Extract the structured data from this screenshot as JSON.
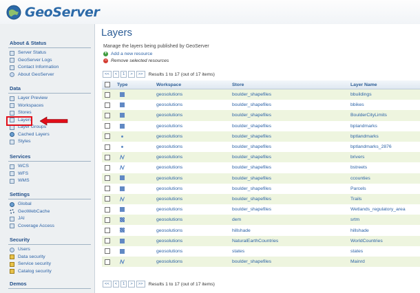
{
  "app": {
    "name": "GeoServer"
  },
  "sidebar": {
    "sections": [
      {
        "title": "About & Status",
        "items": [
          {
            "label": "Server Status",
            "icon": "server-status-icon"
          },
          {
            "label": "GeoServer Logs",
            "icon": "logs-icon"
          },
          {
            "label": "Contact Information",
            "icon": "contact-icon"
          },
          {
            "label": "About GeoServer",
            "icon": "about-icon"
          }
        ]
      },
      {
        "title": "Data",
        "items": [
          {
            "label": "Layer Preview",
            "icon": "layer-preview-icon"
          },
          {
            "label": "Workspaces",
            "icon": "workspaces-icon"
          },
          {
            "label": "Stores",
            "icon": "stores-icon"
          },
          {
            "label": "Layers",
            "icon": "layers-icon"
          },
          {
            "label": "Layer Groups",
            "icon": "layer-groups-icon"
          },
          {
            "label": "Cached Layers",
            "icon": "cached-layers-icon"
          },
          {
            "label": "Styles",
            "icon": "styles-icon"
          }
        ]
      },
      {
        "title": "Services",
        "items": [
          {
            "label": "WCS",
            "icon": "wcs-icon"
          },
          {
            "label": "WFS",
            "icon": "wfs-icon"
          },
          {
            "label": "WMS",
            "icon": "wms-icon"
          }
        ]
      },
      {
        "title": "Settings",
        "items": [
          {
            "label": "Global",
            "icon": "global-icon"
          },
          {
            "label": "GeoWebCache",
            "icon": "geowebcache-icon"
          },
          {
            "label": "JAI",
            "icon": "jai-icon"
          },
          {
            "label": "Coverage Access",
            "icon": "coverage-access-icon"
          }
        ]
      },
      {
        "title": "Security",
        "items": [
          {
            "label": "Users",
            "icon": "users-icon"
          },
          {
            "label": "Data security",
            "icon": "data-security-icon"
          },
          {
            "label": "Service security",
            "icon": "service-security-icon"
          },
          {
            "label": "Catalog security",
            "icon": "catalog-security-icon"
          }
        ]
      },
      {
        "title": "Demos",
        "items": []
      }
    ]
  },
  "main": {
    "title": "Layers",
    "description": "Manage the layers being published by GeoServer",
    "add_label": "Add a new resource",
    "remove_label": "Remove selected resources",
    "pager": {
      "first": "<<",
      "prev": "<",
      "page": "1",
      "next": ">",
      "last": ">>",
      "summary": "Results 1 to 17 (out of 17 items)"
    },
    "table": {
      "headers": [
        "Type",
        "Workspace",
        "Store",
        "Layer Name"
      ],
      "rows": [
        {
          "type": "polygon",
          "workspace": "geosolutions",
          "store": "boulder_shapefiles",
          "layer": "bbuildings"
        },
        {
          "type": "polygon",
          "workspace": "geosolutions",
          "store": "boulder_shapefiles",
          "layer": "bbikes"
        },
        {
          "type": "polygon",
          "workspace": "geosolutions",
          "store": "boulder_shapefiles",
          "layer": "BoulderCityLimits"
        },
        {
          "type": "polygon",
          "workspace": "geosolutions",
          "store": "boulder_shapefiles",
          "layer": "bplandmarks"
        },
        {
          "type": "point",
          "workspace": "geosolutions",
          "store": "boulder_shapefiles",
          "layer": "bptlandmarks"
        },
        {
          "type": "point",
          "workspace": "geosolutions",
          "store": "boulder_shapefiles",
          "layer": "bptlandmarks_2876"
        },
        {
          "type": "line",
          "workspace": "geosolutions",
          "store": "boulder_shapefiles",
          "layer": "brivers"
        },
        {
          "type": "line",
          "workspace": "geosolutions",
          "store": "boulder_shapefiles",
          "layer": "bstreets"
        },
        {
          "type": "polygon",
          "workspace": "geosolutions",
          "store": "boulder_shapefiles",
          "layer": "ccounties"
        },
        {
          "type": "polygon",
          "workspace": "geosolutions",
          "store": "boulder_shapefiles",
          "layer": "Parcels"
        },
        {
          "type": "line",
          "workspace": "geosolutions",
          "store": "boulder_shapefiles",
          "layer": "Trails"
        },
        {
          "type": "polygon",
          "workspace": "geosolutions",
          "store": "boulder_shapefiles",
          "layer": "Wetlands_regulatory_area"
        },
        {
          "type": "raster",
          "workspace": "geosolutions",
          "store": "dem",
          "layer": "srtm"
        },
        {
          "type": "raster",
          "workspace": "geosolutions",
          "store": "hillshade",
          "layer": "hillshade"
        },
        {
          "type": "polygon",
          "workspace": "geosolutions",
          "store": "NaturalEarthCountries",
          "layer": "WorldCountries"
        },
        {
          "type": "polygon",
          "workspace": "geosolutions",
          "store": "states",
          "layer": "states"
        },
        {
          "type": "line",
          "workspace": "geosolutions",
          "store": "boulder_shapefiles",
          "layer": "Mainrd"
        }
      ]
    }
  },
  "colors": {
    "accent": "#2c5d96",
    "link": "#2b62a6",
    "row_alt": "#eef5df",
    "highlight": "#e10d18"
  }
}
